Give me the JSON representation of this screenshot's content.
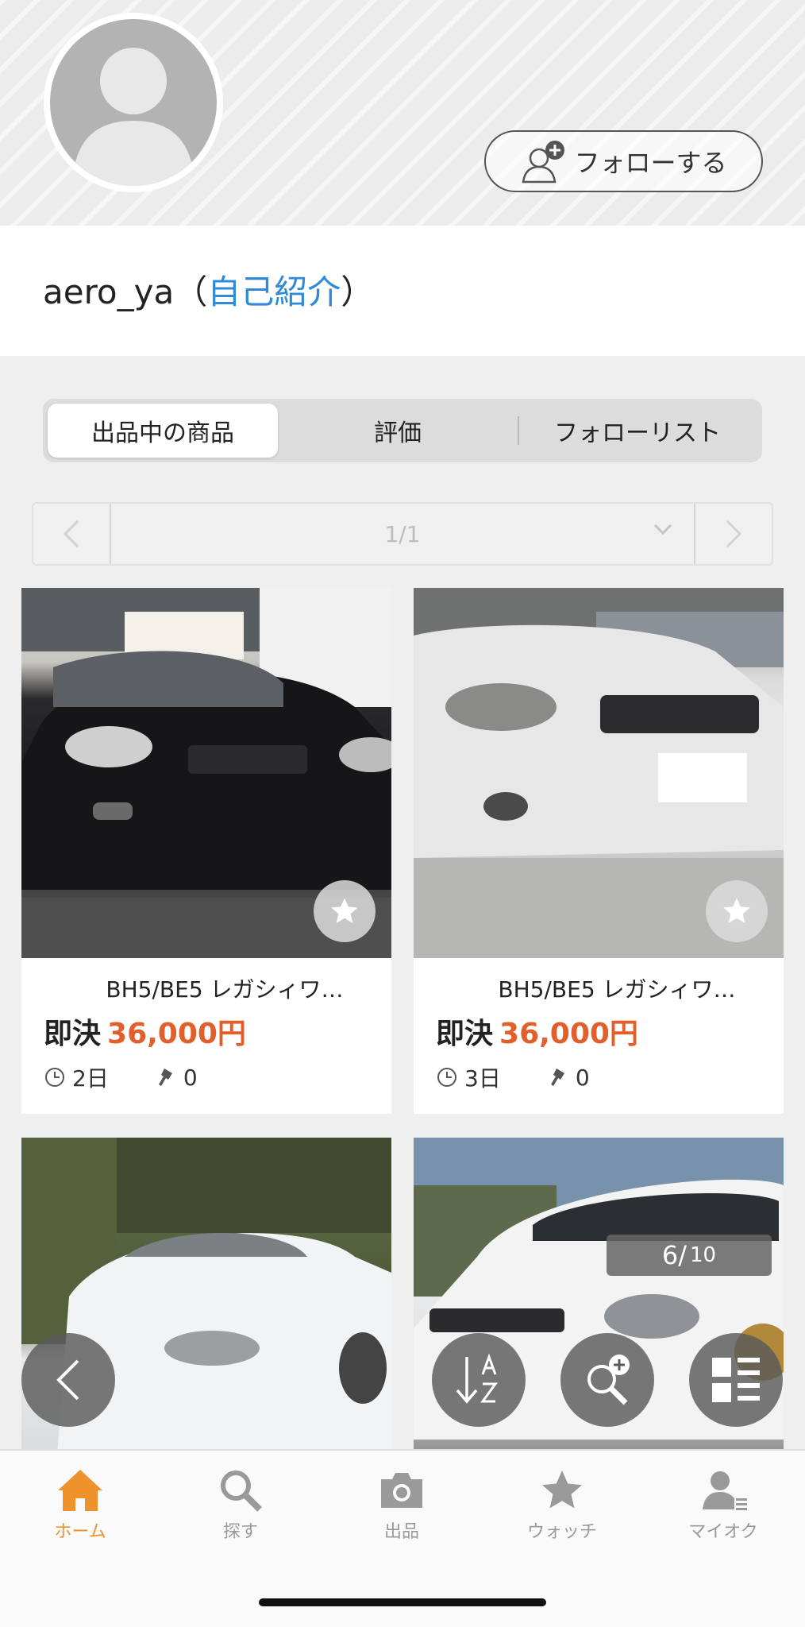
{
  "profile": {
    "follow_button": "フォローする",
    "username": "aero_ya",
    "paren_open": "（",
    "self_intro_link": "自己紹介",
    "paren_close": "）"
  },
  "tabs": [
    "出品中の商品",
    "評価",
    "フォローリスト"
  ],
  "pager": {
    "current": "1/1"
  },
  "items": [
    {
      "title": "BH5/BE5 レガシィワ…",
      "price_label": "即決",
      "price": "36,000円",
      "time_left": "2日",
      "bids": "0"
    },
    {
      "title": "BH5/BE5 レガシィワ…",
      "price_label": "即決",
      "price": "36,000円",
      "time_left": "3日",
      "bids": "0"
    }
  ],
  "page_counter": {
    "current": "6/",
    "total": "10"
  },
  "nav": [
    {
      "label": "ホーム",
      "icon": "home-icon",
      "active": true
    },
    {
      "label": "探す",
      "icon": "search-icon",
      "active": false
    },
    {
      "label": "出品",
      "icon": "camera-icon",
      "active": false
    },
    {
      "label": "ウォッチ",
      "icon": "star-icon",
      "active": false
    },
    {
      "label": "マイオク",
      "icon": "user-list-icon",
      "active": false
    }
  ],
  "colors": {
    "accent": "#f0922c",
    "price": "#e25e2a",
    "link": "#2f8ad8"
  }
}
